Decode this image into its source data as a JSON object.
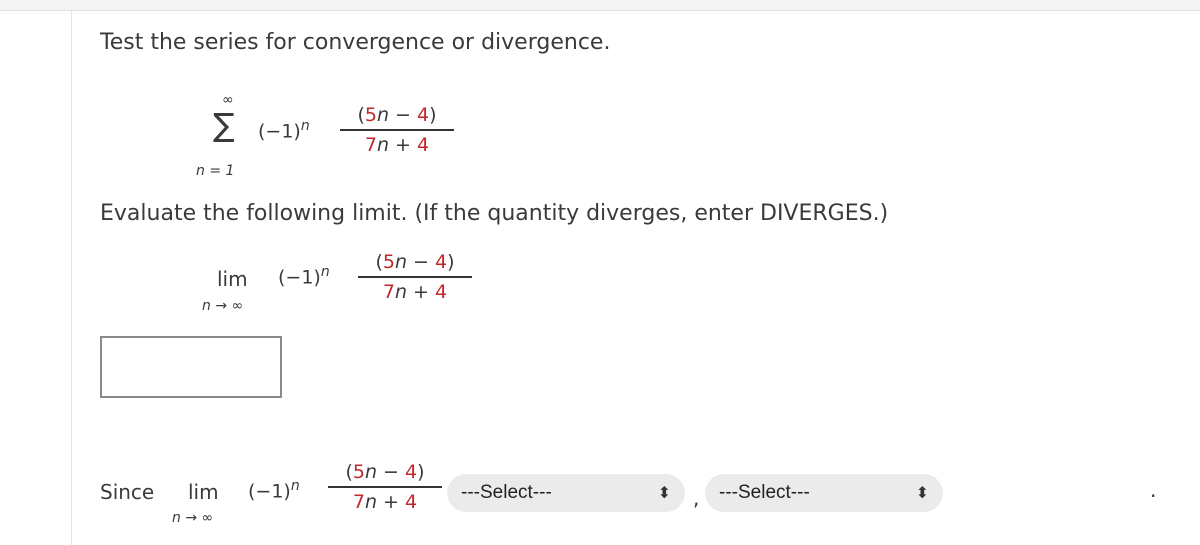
{
  "question": {
    "prompt": "Test the series for convergence or divergence.",
    "series": {
      "sum_upper": "∞",
      "sum_lower": "n = 1",
      "factor_base": "(−1)",
      "factor_exp": "n",
      "num_open": "(",
      "num_a": "5",
      "num_var": "n",
      "num_op": " − ",
      "num_b": "4",
      "num_close": ")",
      "den_a": "7",
      "den_var": "n",
      "den_op": " + ",
      "den_b": "4"
    },
    "instruction": "Evaluate the following limit. (If the quantity diverges, enter DIVERGES.)",
    "limit": {
      "lim_label": "lim",
      "lim_sub": "n → ∞"
    },
    "answer": {
      "value": "",
      "placeholder": ""
    },
    "conclusion": {
      "since_label": "Since",
      "select1": {
        "selected": "---Select---"
      },
      "separator": ",",
      "select2": {
        "selected": "---Select---"
      },
      "end_punct": "."
    }
  },
  "colors": {
    "highlight": "#c0272d",
    "text": "#3a3a3a",
    "select_bg": "#ebebeb"
  },
  "icons": {
    "select_arrow": "up-down-chevron-icon"
  }
}
